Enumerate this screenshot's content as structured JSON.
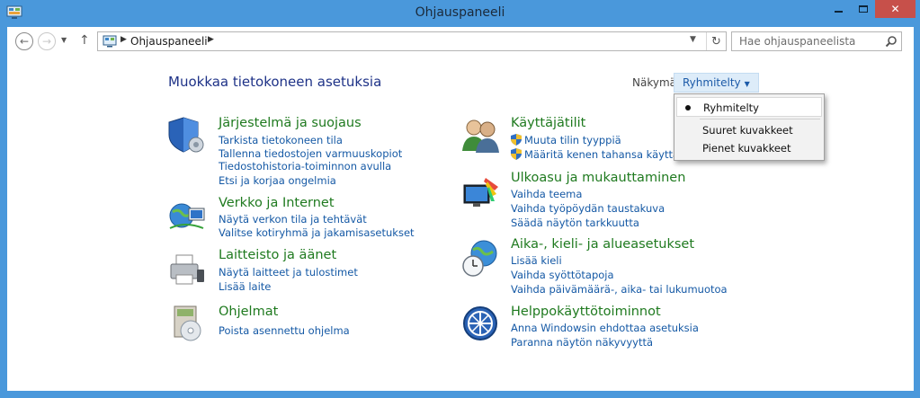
{
  "window": {
    "title": "Ohjauspaneeli",
    "accent": "#4a98db",
    "close_color": "#c7504a"
  },
  "nav": {
    "back_icon": "back-arrow-icon",
    "forward_icon": "forward-arrow-icon",
    "up_icon": "up-arrow-icon",
    "address_path": "Ohjauspaneeli",
    "search_placeholder": "Hae ohjauspaneelista"
  },
  "header": {
    "title": "Muokkaa tietokoneen asetuksia"
  },
  "view": {
    "label": "Näkymä:",
    "current": "Ryhmitelty",
    "options": [
      "Ryhmitelty",
      "Suuret kuvakkeet",
      "Pienet kuvakkeet"
    ]
  },
  "categories_left": [
    {
      "title": "Järjestelmä ja suojaus",
      "links": [
        "Tarkista tietokoneen tila",
        "Tallenna tiedostojen varmuuskopiot",
        "Tiedostohistoria-toiminnon avulla",
        "Etsi ja korjaa ongelmia"
      ]
    },
    {
      "title": "Verkko ja Internet",
      "links": [
        "Näytä verkon tila ja tehtävät",
        "Valitse kotiryhmä ja jakamisasetukset"
      ]
    },
    {
      "title": "Laitteisto ja äänet",
      "links": [
        "Näytä laitteet ja tulostimet",
        "Lisää laite"
      ]
    },
    {
      "title": "Ohjelmat",
      "links": [
        "Poista asennettu ohjelma"
      ]
    }
  ],
  "categories_right": [
    {
      "title": "Käyttäjätilit",
      "links": [
        "Muuta tilin tyyppiä",
        "Määritä kenen tahansa käyttäjän p"
      ]
    },
    {
      "title": "Ulkoasu ja mukauttaminen",
      "links": [
        "Vaihda teema",
        "Vaihda työpöydän taustakuva",
        "Säädä näytön tarkkuutta"
      ]
    },
    {
      "title": "Aika-, kieli- ja alueasetukset",
      "links": [
        "Lisää kieli",
        "Vaihda syöttötapoja",
        "Vaihda päivämäärä-, aika- tai lukumuotoa"
      ]
    },
    {
      "title": "Helppokäyttötoiminnot",
      "links": [
        "Anna Windowsin ehdottaa asetuksia",
        "Paranna näytön näkyvyyttä"
      ]
    }
  ]
}
